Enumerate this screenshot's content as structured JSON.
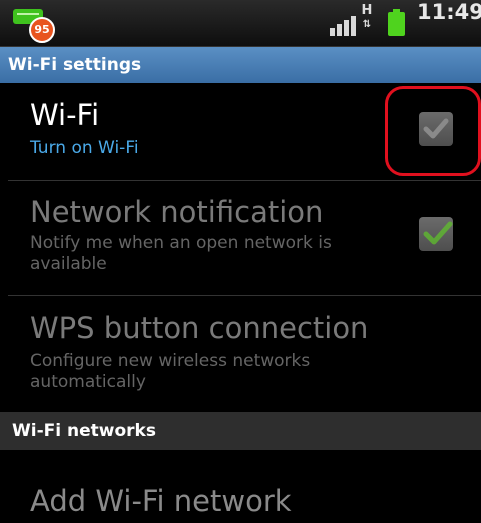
{
  "status_bar": {
    "notification_badge": "95",
    "network_type": "H",
    "time": "11:49",
    "icons": [
      "app-notification-icon",
      "hspa-data-icon",
      "signal-icon",
      "battery-icon"
    ]
  },
  "header": {
    "title": "Wi-Fi settings"
  },
  "items": [
    {
      "title": "Wi-Fi",
      "subtitle": "Turn on Wi-Fi",
      "checked": false,
      "enabled": true
    },
    {
      "title": "Network notification",
      "subtitle": "Notify me when an open network is available",
      "checked": true,
      "enabled": false
    },
    {
      "title": "WPS button connection",
      "subtitle": "Configure new wireless networks automatically",
      "enabled": false
    }
  ],
  "section": {
    "title": "Wi-Fi networks"
  },
  "add_network": {
    "title": "Add Wi-Fi network"
  },
  "colors": {
    "accent_blue": "#3a6ea5",
    "subtitle_blue": "#4aa9e8",
    "check_green": "#5fc62a",
    "highlight_red": "#e0101e"
  }
}
